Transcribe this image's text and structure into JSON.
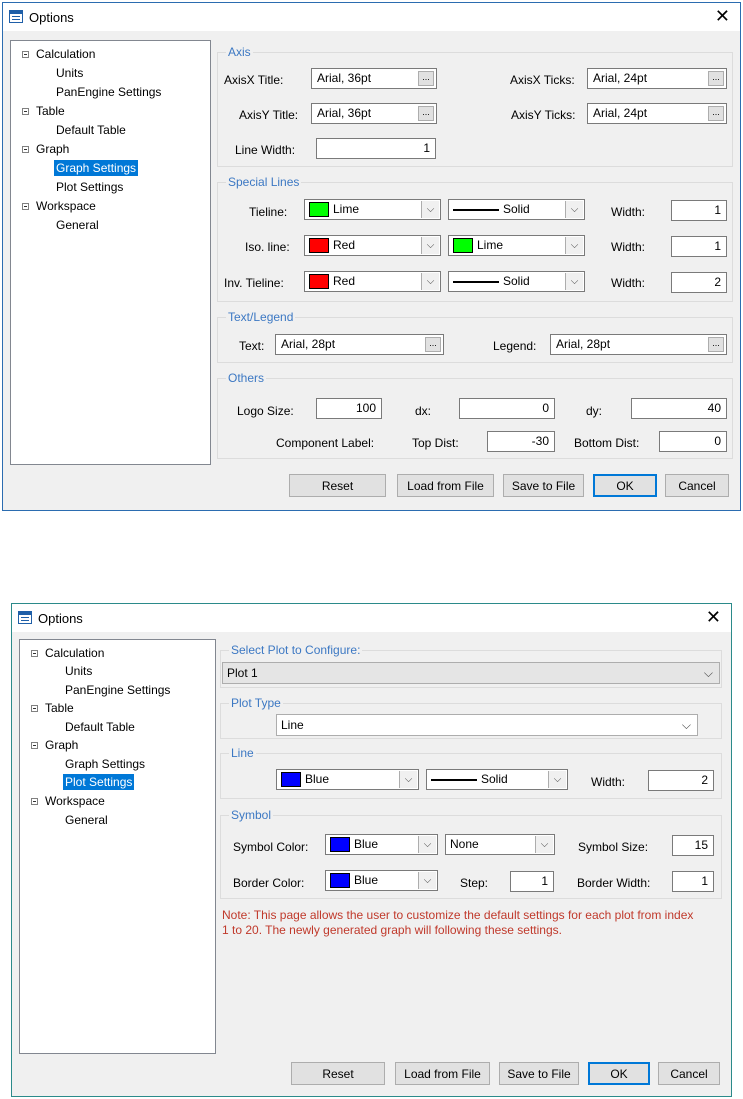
{
  "window1": {
    "title": "Options",
    "close": "✕",
    "tree": [
      {
        "label": "Calculation",
        "expander": true
      },
      {
        "label": "Units"
      },
      {
        "label": "PanEngine Settings"
      },
      {
        "label": "Table",
        "expander": true
      },
      {
        "label": "Default Table"
      },
      {
        "label": "Graph",
        "expander": true
      },
      {
        "label": "Graph Settings",
        "selected": true
      },
      {
        "label": "Plot Settings"
      },
      {
        "label": "Workspace",
        "expander": true
      },
      {
        "label": "General"
      }
    ],
    "axis": {
      "group": "Axis",
      "x_title_label": "AxisX Title:",
      "x_title_value": "Arial, 36pt",
      "x_ticks_label": "AxisX Ticks:",
      "x_ticks_value": "Arial, 24pt",
      "y_title_label": "AxisY Title:",
      "y_title_value": "Arial, 36pt",
      "y_ticks_label": "AxisY Ticks:",
      "y_ticks_value": "Arial, 24pt",
      "line_width_label": "Line Width:",
      "line_width_value": "1",
      "dots": "..."
    },
    "special_lines": {
      "group": "Special Lines",
      "tieline_label": "Tieline:",
      "tieline_color": "Lime",
      "tieline_color_hex": "#00ff00",
      "tieline_style": "Solid",
      "tieline_width_label": "Width:",
      "tieline_width": "1",
      "iso_label": "Iso. line:",
      "iso_color": "Red",
      "iso_color_hex": "#ff0000",
      "iso_color2": "Lime",
      "iso_color2_hex": "#00ff00",
      "iso_width_label": "Width:",
      "iso_width": "1",
      "inv_label": "Inv. Tieline:",
      "inv_color": "Red",
      "inv_color_hex": "#ff0000",
      "inv_style": "Solid",
      "inv_width_label": "Width:",
      "inv_width": "2"
    },
    "text_legend": {
      "group": "Text/Legend",
      "text_label": "Text:",
      "text_value": "Arial, 28pt",
      "legend_label": "Legend:",
      "legend_value": "Arial, 28pt"
    },
    "others": {
      "group": "Others",
      "logo_label": "Logo Size:",
      "logo_value": "100",
      "dx_label": "dx:",
      "dx_value": "0",
      "dy_label": "dy:",
      "dy_value": "40",
      "component_label": "Component Label:",
      "top_label": "Top Dist:",
      "top_value": "-30",
      "bottom_label": "Bottom Dist:",
      "bottom_value": "0"
    },
    "buttons": {
      "reset": "Reset",
      "load": "Load from File",
      "save": "Save to File",
      "ok": "OK",
      "cancel": "Cancel"
    }
  },
  "window2": {
    "title": "Options",
    "close": "✕",
    "tree": [
      {
        "label": "Calculation",
        "expander": true
      },
      {
        "label": "Units"
      },
      {
        "label": "PanEngine Settings"
      },
      {
        "label": "Table",
        "expander": true
      },
      {
        "label": "Default Table"
      },
      {
        "label": "Graph",
        "expander": true
      },
      {
        "label": "Graph Settings"
      },
      {
        "label": "Plot Settings",
        "selected": true
      },
      {
        "label": "Workspace",
        "expander": true
      },
      {
        "label": "General"
      }
    ],
    "select_plot": {
      "group": "Select Plot to Configure:",
      "value": "Plot 1"
    },
    "plot_type": {
      "group": "Plot Type",
      "value": "Line"
    },
    "line": {
      "group": "Line",
      "color": "Blue",
      "color_hex": "#0000ff",
      "style": "Solid",
      "width_label": "Width:",
      "width": "2"
    },
    "symbol": {
      "group": "Symbol",
      "color_label": "Symbol Color:",
      "color": "Blue",
      "color_hex": "#0000ff",
      "shape": "None",
      "size_label": "Symbol Size:",
      "size": "15",
      "border_label": "Border Color:",
      "border_color": "Blue",
      "border_hex": "#0000ff",
      "step_label": "Step:",
      "step": "1",
      "border_width_label": "Border Width:",
      "border_width": "1"
    },
    "note_line1": "Note: This page allows the user to customize the default settings for each plot from index",
    "note_line2": "1 to 20. The newly generated graph will following these settings.",
    "buttons": {
      "reset": "Reset",
      "load": "Load from File",
      "save": "Save to File",
      "ok": "OK",
      "cancel": "Cancel"
    }
  }
}
